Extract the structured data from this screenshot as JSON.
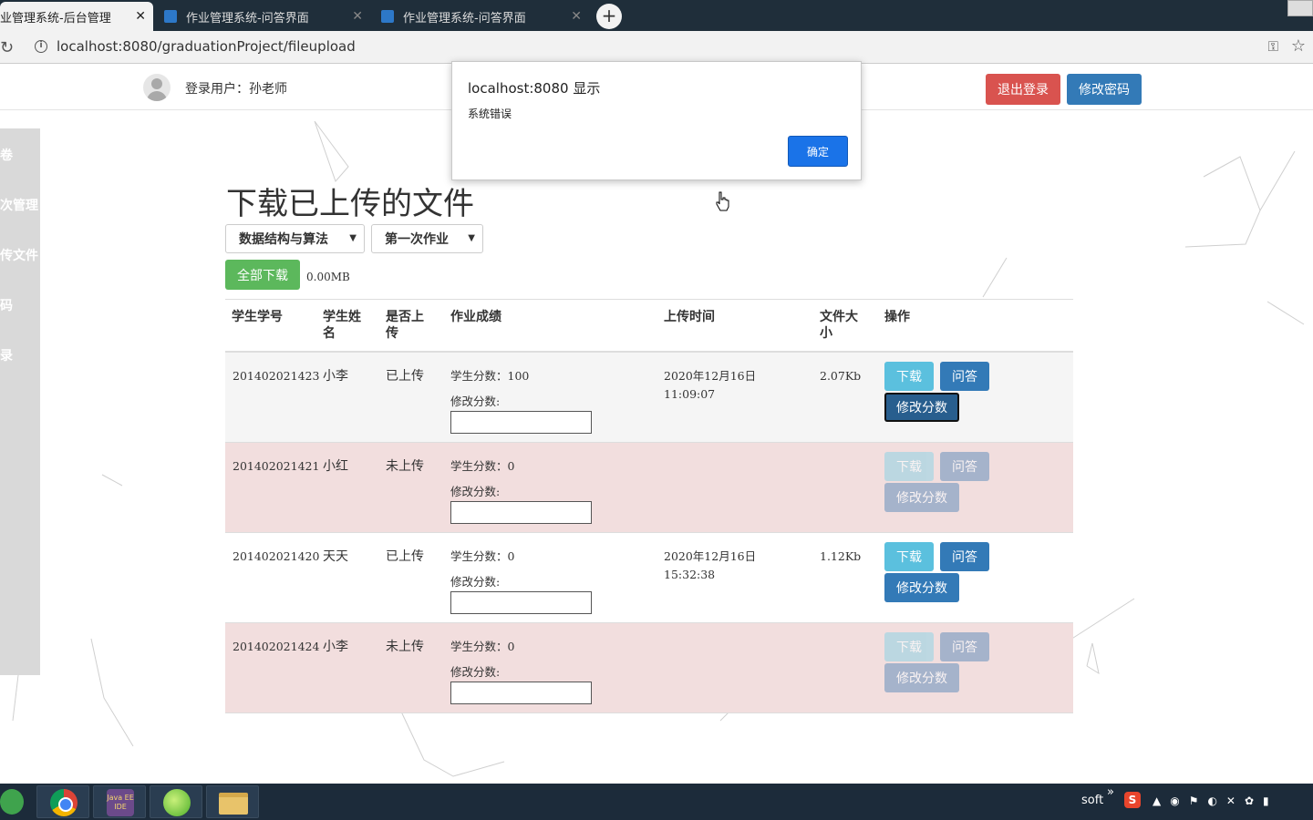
{
  "browser": {
    "tabs": [
      {
        "label": "业管理系统-后台管理",
        "active": true
      },
      {
        "label": "作业管理系统-问答界面",
        "active": false
      },
      {
        "label": "作业管理系统-问答界面",
        "active": false
      }
    ],
    "new_tab": "+",
    "url": "localhost:8080/graduationProject/fileupload"
  },
  "header": {
    "login_user": "登录用户：孙老师",
    "logout_label": "退出登录",
    "change_password_label": "修改密码"
  },
  "sidebar": {
    "items": [
      {
        "label": "卷"
      },
      {
        "label": "次管理"
      },
      {
        "label": "传文件"
      },
      {
        "label": "码"
      },
      {
        "label": "录"
      }
    ]
  },
  "main": {
    "title": "下载已上传的文件",
    "course_select": "数据结构与算法",
    "assignment_select": "第一次作业",
    "download_all_label": "全部下载",
    "total_size": "0.00MB",
    "table": {
      "headers": {
        "id": "学生学号",
        "name_1": "学生姓",
        "name_2": "名",
        "uploaded_1": "是否上",
        "uploaded_2": "传",
        "score": "作业成绩",
        "time": "上传时间",
        "size_1": "文件大",
        "size_2": "小",
        "ops": "操作"
      },
      "rows": [
        {
          "id": "201402021423",
          "name": "小李",
          "uploaded": "已上传",
          "score": "学生分数：100",
          "modify_label": "修改分数:",
          "date": "2020年12月16日",
          "time": "11:09:07",
          "size": "2.07Kb",
          "download": "下载",
          "qa": "问答",
          "modify_btn": "修改分数"
        },
        {
          "id": "201402021421",
          "name": "小红",
          "uploaded": "未上传",
          "score": "学生分数：0",
          "modify_label": "修改分数:",
          "date": "",
          "time": "",
          "size": "",
          "download": "下载",
          "qa": "问答",
          "modify_btn": "修改分数"
        },
        {
          "id": "201402021420",
          "name": "天天",
          "uploaded": "已上传",
          "score": "学生分数：0",
          "modify_label": "修改分数:",
          "date": "2020年12月16日",
          "time": "15:32:38",
          "size": "1.12Kb",
          "download": "下载",
          "qa": "问答",
          "modify_btn": "修改分数"
        },
        {
          "id": "201402021424",
          "name": "小李",
          "uploaded": "未上传",
          "score": "学生分数：0",
          "modify_label": "修改分数:",
          "date": "",
          "time": "",
          "size": "",
          "download": "下载",
          "qa": "问答",
          "modify_btn": "修改分数"
        }
      ]
    }
  },
  "dialog": {
    "title": "localhost:8080 显示",
    "message": "系统错误",
    "ok_label": "确定"
  },
  "taskbar": {
    "java_label": "Java EE IDE",
    "tray_text": "soft",
    "tray_chevron": "»",
    "tray_s": "S"
  },
  "colors": {
    "danger": "#d9534f",
    "primary": "#337ab7",
    "info": "#5bc0de",
    "success": "#5cb85c",
    "row_danger": "#f2dede"
  }
}
